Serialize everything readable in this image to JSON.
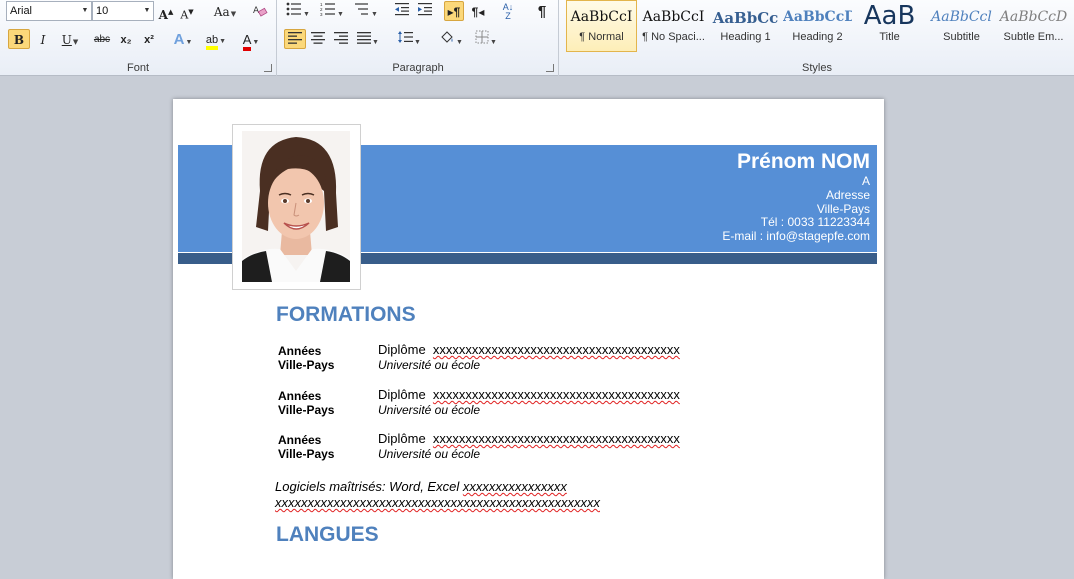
{
  "ribbon": {
    "font": {
      "label": "Font",
      "family": "Arial",
      "size": "10",
      "grow": "A",
      "shrink": "A",
      "change_case": "Aa",
      "bold": "B",
      "italic": "I",
      "underline": "U",
      "strike": "abc",
      "subscript": "x₂",
      "superscript": "x²",
      "text_effects": "A",
      "highlight": "ab",
      "font_color": "A"
    },
    "paragraph": {
      "label": "Paragraph",
      "pilcrow": "¶"
    },
    "styles": {
      "label": "Styles",
      "items": [
        {
          "sample": "AaBbCcI",
          "name": "¶ Normal"
        },
        {
          "sample": "AaBbCcI",
          "name": "¶ No Spaci..."
        },
        {
          "sample": "AaBbCc",
          "name": "Heading 1"
        },
        {
          "sample": "AaBbCcD",
          "name": "Heading 2"
        },
        {
          "sample": "AaB",
          "name": "Title"
        },
        {
          "sample": "AaBbCcl",
          "name": "Subtitle"
        },
        {
          "sample": "AaBbCcD",
          "name": "Subtle Em..."
        }
      ]
    }
  },
  "document": {
    "header": {
      "name": "Prénom NOM",
      "line1": "A",
      "address": "Adresse",
      "city_country": "Ville-Pays",
      "phone": "Tél : 0033 11223344",
      "email": "E-mail : info@stagepfe.com"
    },
    "formations_title": "FORMATIONS",
    "formations": [
      {
        "year": "Années",
        "city": "Ville-Pays",
        "diploma": "Diplôme",
        "filler": "xxxxxxxxxxxxxxxxxxxxxxxxxxxxxxxxxxxxxx",
        "school": "Université ou école"
      },
      {
        "year": "Années",
        "city": "Ville-Pays",
        "diploma": "Diplôme",
        "filler": "xxxxxxxxxxxxxxxxxxxxxxxxxxxxxxxxxxxxxx",
        "school": "Université ou école"
      },
      {
        "year": "Années",
        "city": "Ville-Pays",
        "diploma": "Diplôme",
        "filler": "xxxxxxxxxxxxxxxxxxxxxxxxxxxxxxxxxxxxxx",
        "school": "Université ou école"
      }
    ],
    "software_prefix": "Logiciels maîtrisés: Word, Excel",
    "software_filler1": "xxxxxxxxxxxxxxxx",
    "software_filler2": "xxxxxxxxxxxxxxxxxxxxxxxxxxxxxxxxxxxxxxxxxxxxxxxxxx",
    "langues_title": "LANGUES"
  },
  "colors": {
    "banner": "#568fd6",
    "banner_bar": "#385d8a",
    "heading": "#4f81bd"
  }
}
